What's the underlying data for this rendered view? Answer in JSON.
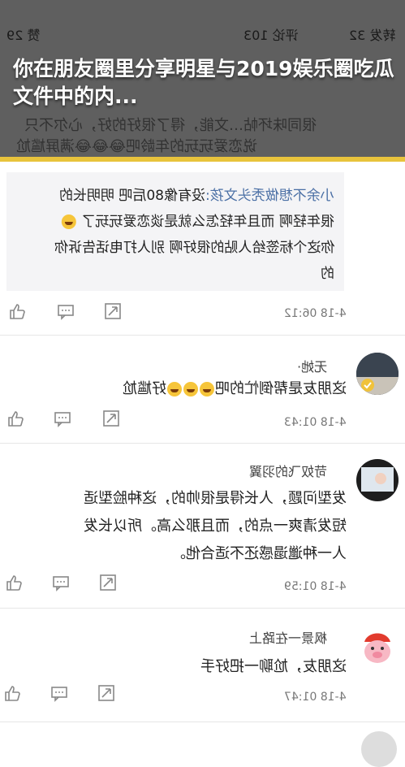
{
  "top": {
    "likes": "赞 29",
    "comments": "评论 103",
    "favs": "转发 32",
    "headline": "你在朋友圈里分享明星与2019娱乐圈吃瓜文件中的内...",
    "bg_line1": "说恋爱玩玩的年龄吧😂😂😂满屏尴尬",
    "bg_line2": "很同味坏帖…文能，得了很好的好，心尔不只"
  },
  "quote": {
    "author": "小余不想做秃头文孩:",
    "line1_text": "没有像80后吧 明明长的",
    "line2": "很年轻啊 而且年轻怎么就是谈恋爱玩玩了",
    "line3": "你这个标签给人贴的很好啊 别人打电话告诉你",
    "line4": "的"
  },
  "comments": [
    {
      "time": "4-18 06:12"
    },
    {
      "name": "无她·",
      "text": "这朋友是帮倒忙的吧",
      "text_tail": "好尴尬",
      "time": "4-18 01:43"
    },
    {
      "name": "苛奴飞的羽翼",
      "line1": "发型问题，人长得是很帅的，这种脸型适",
      "line2": "短发清爽一点的，而且那么高。所以长发",
      "line3": "人一种邋遢感还不适合他。",
      "time": "4-18 01:59"
    },
    {
      "name": "枫景一在路上",
      "text": "这朋友，尬聊一把好手",
      "time": "4-18 01:47"
    }
  ],
  "colors": {
    "headline_bg": "#5f5f5f",
    "accent": "#e8c33c",
    "link": "#4a6fa5"
  }
}
